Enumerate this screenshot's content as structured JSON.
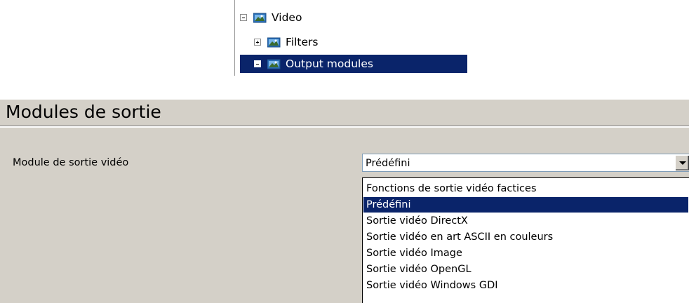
{
  "tree": {
    "items": [
      {
        "label": "Video",
        "expander": "minus",
        "selected": false
      },
      {
        "label": "Filters",
        "expander": "plus",
        "selected": false
      },
      {
        "label": "Output modules",
        "expander": "minus",
        "selected": true
      }
    ]
  },
  "section": {
    "title": "Modules de sortie"
  },
  "setting": {
    "label": "Module de sortie vidéo",
    "selected_value": "Prédéfini",
    "options": [
      {
        "label": "Fonctions de sortie vidéo factices",
        "highlighted": false
      },
      {
        "label": "Prédéfini",
        "highlighted": true
      },
      {
        "label": "Sortie vidéo DirectX",
        "highlighted": false
      },
      {
        "label": "Sortie vidéo en art ASCII en couleurs",
        "highlighted": false
      },
      {
        "label": "Sortie vidéo Image",
        "highlighted": false
      },
      {
        "label": "Sortie vidéo OpenGL",
        "highlighted": false
      },
      {
        "label": "Sortie vidéo Windows GDI",
        "highlighted": false
      }
    ]
  },
  "colors": {
    "selection": "#0a246a",
    "panel": "#d4d0c8",
    "icons": [
      "folder-image-icon",
      "expand-plus-icon",
      "collapse-minus-icon",
      "dropdown-arrow-icon"
    ]
  }
}
